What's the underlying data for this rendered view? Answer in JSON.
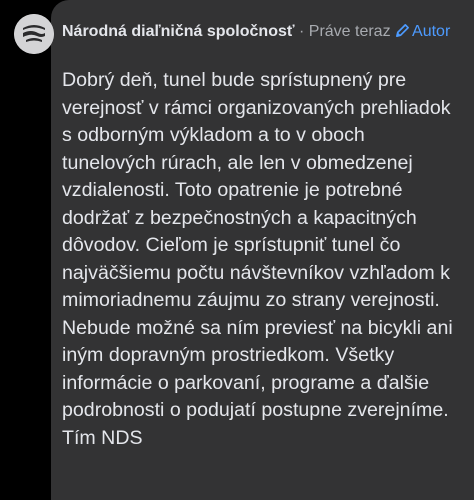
{
  "comment": {
    "author": "Národná diaľničná spoločnosť",
    "separator": "·",
    "time": "Práve teraz",
    "badge_label": "Autor",
    "badge_icon": "pencil-icon",
    "avatar_icon": "nds-logo-icon",
    "text": "Dobrý deň, tunel bude sprístupnený pre verejnosť v rámci organizovaných prehliadok s odborným výkladom a to v oboch tunelových rúrach, ale len v obmedzenej vzdialenosti. Toto opatrenie je potrebné dodržať z bezpečnostných a kapacitných dôvodov. Cieľom je sprístupniť tunel čo najväčšiemu počtu návštevníkov vzhľadom k mimoriadnemu záujmu zo strany verejnosti. Nebude možné sa ním previesť na bicykli ani iným dopravným prostriedkom. Všetky informácie o parkovaní, programe a ďalšie podrobnosti o podujatí postupne zverejníme. Tím NDS"
  },
  "colors": {
    "background": "#000000",
    "bubble": "#333334",
    "text": "#e4e6eb",
    "muted": "#a8abb0",
    "accent": "#4d9bff"
  }
}
